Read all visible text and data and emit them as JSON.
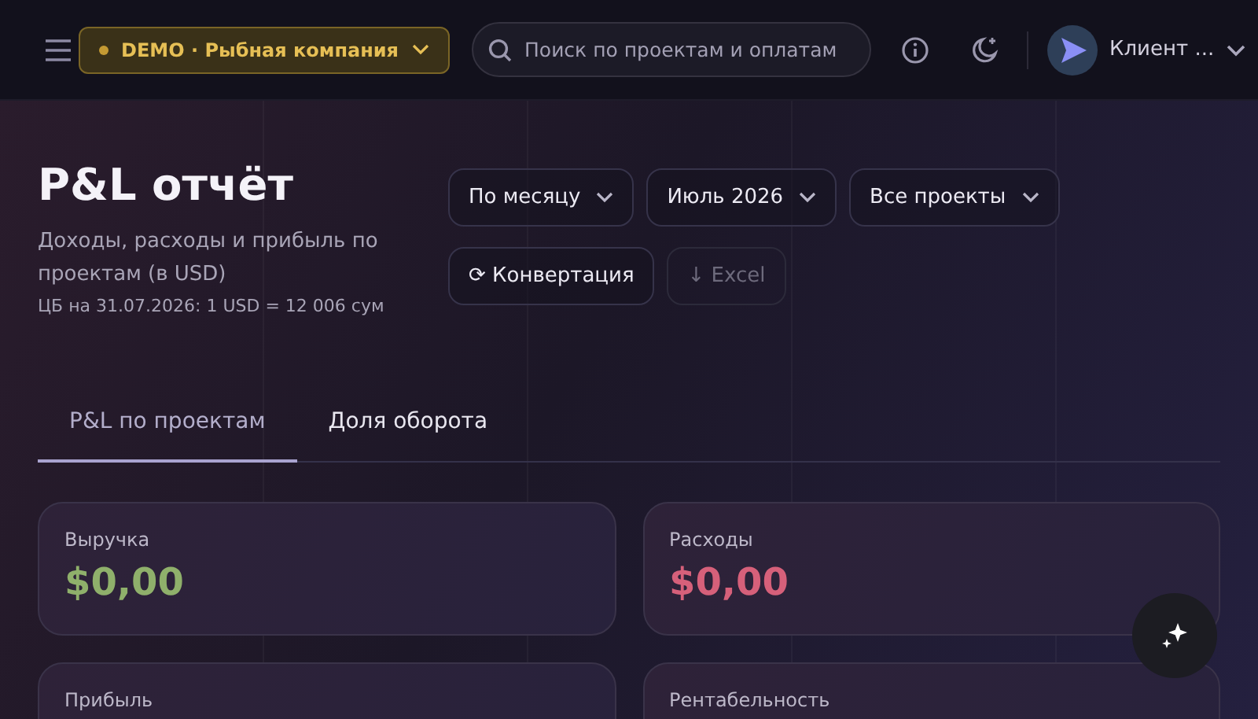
{
  "topbar": {
    "company": {
      "label": "DEMO · Рыбная компания"
    },
    "search": {
      "placeholder": "Поиск по проектам и оплатам"
    },
    "user": {
      "name": "Клиент ..."
    }
  },
  "header": {
    "title": "P&L отчёт",
    "subtitle": "Доходы, расходы и прибыль по проектам (в USD)",
    "rate_note": "ЦБ на 31.07.2026: 1 USD = 12 006 сум"
  },
  "filters": [
    {
      "label": "По месяцу",
      "kind": "dropdown",
      "disabled": false
    },
    {
      "label": "Июль 2026",
      "kind": "dropdown",
      "disabled": false
    },
    {
      "label": "Все проекты",
      "kind": "dropdown",
      "disabled": false
    },
    {
      "label": "⟳ Конвертация",
      "kind": "button",
      "disabled": false
    },
    {
      "label": "↓ Excel",
      "kind": "button",
      "disabled": true
    }
  ],
  "tabs": [
    {
      "label": "P&L по проектам",
      "selected": true
    },
    {
      "label": "Доля оборота",
      "selected": false
    }
  ],
  "cards": [
    {
      "label": "Выручка",
      "value": "$0,00",
      "color": "#8fb06b"
    },
    {
      "label": "Расходы",
      "value": "$0,00",
      "color": "#d6607a"
    },
    {
      "label": "Прибыль"
    },
    {
      "label": "Рентабельность"
    }
  ]
}
